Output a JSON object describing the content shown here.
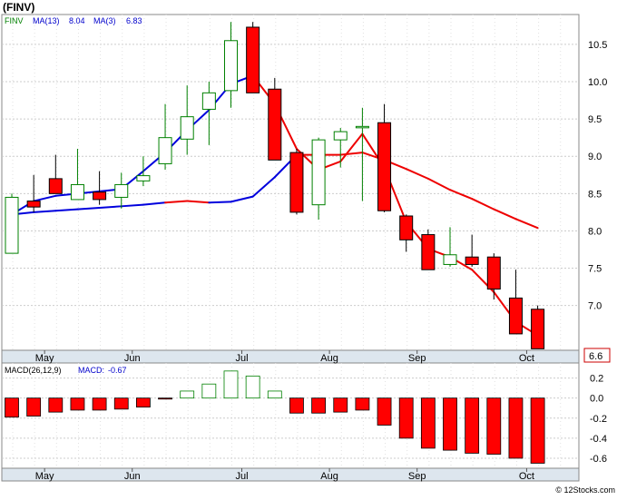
{
  "header": {
    "title": "(FINV)",
    "legend": [
      {
        "label": "FINV",
        "value": "",
        "color": "#008000"
      },
      {
        "label": "MA(13)",
        "value": "8.04",
        "color": "#0000cc"
      },
      {
        "label": "MA(3)",
        "value": "6.83",
        "color": "#0000cc"
      }
    ]
  },
  "last_price_label": "6.6",
  "watermark": "© 12Stocks.com",
  "colors": {
    "up_candle": "#008000",
    "down_candle": "#ff0000",
    "ma_blue": "#0000dd",
    "ma_red": "#ee0000",
    "grid": "#cccccc",
    "macd_bar": "#ff0000",
    "macd_up_outline": "#008000"
  },
  "chart_data": [
    {
      "type": "candlestick",
      "title": "(FINV)",
      "x_tick_labels": [
        "May",
        "Jun",
        "Jul",
        "Aug",
        "Sep",
        "Oct"
      ],
      "y_tick_labels": [
        "7.0",
        "7.5",
        "8.0",
        "8.5",
        "9.0",
        "9.5",
        "10.0",
        "10.5"
      ],
      "ylim": [
        6.4,
        10.9
      ],
      "grid": true,
      "candles": [
        {
          "o": 7.7,
          "h": 8.5,
          "l": 7.7,
          "c": 8.45
        },
        {
          "o": 8.4,
          "h": 8.75,
          "l": 8.25,
          "c": 8.32
        },
        {
          "o": 8.7,
          "h": 9.02,
          "l": 8.5,
          "c": 8.5
        },
        {
          "o": 8.42,
          "h": 9.1,
          "l": 8.42,
          "c": 8.62
        },
        {
          "o": 8.52,
          "h": 8.8,
          "l": 8.35,
          "c": 8.42
        },
        {
          "o": 8.45,
          "h": 8.78,
          "l": 8.3,
          "c": 8.62
        },
        {
          "o": 8.67,
          "h": 9.0,
          "l": 8.6,
          "c": 8.74
        },
        {
          "o": 8.9,
          "h": 9.7,
          "l": 8.82,
          "c": 9.25
        },
        {
          "o": 9.23,
          "h": 9.95,
          "l": 9.02,
          "c": 9.53
        },
        {
          "o": 9.63,
          "h": 10.0,
          "l": 9.15,
          "c": 9.85
        },
        {
          "o": 9.88,
          "h": 10.8,
          "l": 9.65,
          "c": 10.55
        },
        {
          "o": 10.73,
          "h": 10.8,
          "l": 9.85,
          "c": 9.85
        },
        {
          "o": 9.9,
          "h": 10.05,
          "l": 8.95,
          "c": 8.95
        },
        {
          "o": 9.05,
          "h": 9.1,
          "l": 8.22,
          "c": 8.25
        },
        {
          "o": 8.35,
          "h": 9.25,
          "l": 8.15,
          "c": 9.22
        },
        {
          "o": 9.22,
          "h": 9.38,
          "l": 8.85,
          "c": 9.33
        },
        {
          "o": 9.4,
          "h": 9.65,
          "l": 8.4,
          "c": 9.4
        },
        {
          "o": 9.45,
          "h": 9.7,
          "l": 8.25,
          "c": 8.27
        },
        {
          "o": 8.2,
          "h": 8.22,
          "l": 7.72,
          "c": 7.88
        },
        {
          "o": 7.95,
          "h": 8.02,
          "l": 7.48,
          "c": 7.48
        },
        {
          "o": 7.55,
          "h": 8.05,
          "l": 7.52,
          "c": 7.68
        },
        {
          "o": 7.65,
          "h": 7.95,
          "l": 7.52,
          "c": 7.55
        },
        {
          "o": 7.65,
          "h": 7.7,
          "l": 7.08,
          "c": 7.22
        },
        {
          "o": 7.1,
          "h": 7.48,
          "l": 6.62,
          "c": 6.62
        },
        {
          "o": 6.95,
          "h": 7.0,
          "l": 6.42,
          "c": 6.42
        }
      ],
      "series": [
        {
          "values": [
            8.22,
            8.25,
            8.27,
            8.29,
            8.31,
            8.33,
            8.35,
            8.38,
            8.4,
            8.38,
            8.39,
            8.46,
            8.72,
            9.02,
            9.02,
            9.02,
            9.05,
            8.95,
            8.83,
            8.7,
            8.55,
            8.43,
            8.29,
            8.16,
            8.04
          ],
          "segment_colors": [
            "blue",
            "blue",
            "blue",
            "blue",
            "blue",
            "blue",
            "blue",
            "red",
            "red",
            "blue",
            "blue",
            "blue",
            "blue",
            "red",
            "red",
            "red",
            "red",
            "red",
            "red",
            "red",
            "red",
            "red",
            "red",
            "red"
          ]
        },
        {
          "values": [
            8.22,
            8.4,
            8.47,
            8.5,
            8.53,
            8.56,
            8.8,
            9.05,
            9.35,
            9.62,
            9.97,
            10.08,
            null,
            null,
            null,
            null,
            null,
            null,
            null,
            null,
            null,
            null,
            null,
            null,
            null
          ],
          "segment_colors": [
            "blue",
            "blue",
            "blue",
            "blue",
            "blue",
            "blue",
            "blue",
            "blue",
            "blue",
            "blue",
            "blue"
          ],
          "note": ""
        },
        {
          "values": [
            null,
            null,
            null,
            null,
            null,
            null,
            null,
            null,
            null,
            null,
            null,
            10.08,
            9.7,
            9.1,
            8.82,
            8.93,
            9.3,
            8.85,
            8.12,
            7.76,
            7.65,
            7.48,
            7.18,
            6.78,
            6.6
          ],
          "segment_colors": [
            "",
            "",
            "",
            "",
            "",
            "",
            "",
            "",
            "",
            "",
            "",
            "red",
            "red",
            "red",
            "red",
            "red",
            "red",
            "red",
            "red",
            "red",
            "red",
            "red",
            "red",
            "red"
          ]
        }
      ]
    },
    {
      "type": "bar",
      "title": "MACD(26,12,9)",
      "legend": [
        {
          "label": "MACD(26,12,9)",
          "value": ""
        },
        {
          "label": "MACD:",
          "value": "-0.67"
        }
      ],
      "x_tick_labels": [
        "May",
        "Jun",
        "Jul",
        "Aug",
        "Sep",
        "Oct"
      ],
      "y_tick_labels": [
        "0.2",
        "0.0",
        "-0.2",
        "-0.4",
        "-0.6"
      ],
      "ylim": [
        -0.7,
        0.35
      ],
      "grid": true,
      "values": [
        -0.19,
        -0.18,
        -0.14,
        -0.12,
        -0.12,
        -0.11,
        -0.09,
        -0.01,
        0.07,
        0.14,
        0.27,
        0.22,
        0.07,
        -0.15,
        -0.15,
        -0.14,
        -0.12,
        -0.27,
        -0.4,
        -0.5,
        -0.52,
        -0.55,
        -0.56,
        -0.6,
        -0.65
      ]
    }
  ]
}
